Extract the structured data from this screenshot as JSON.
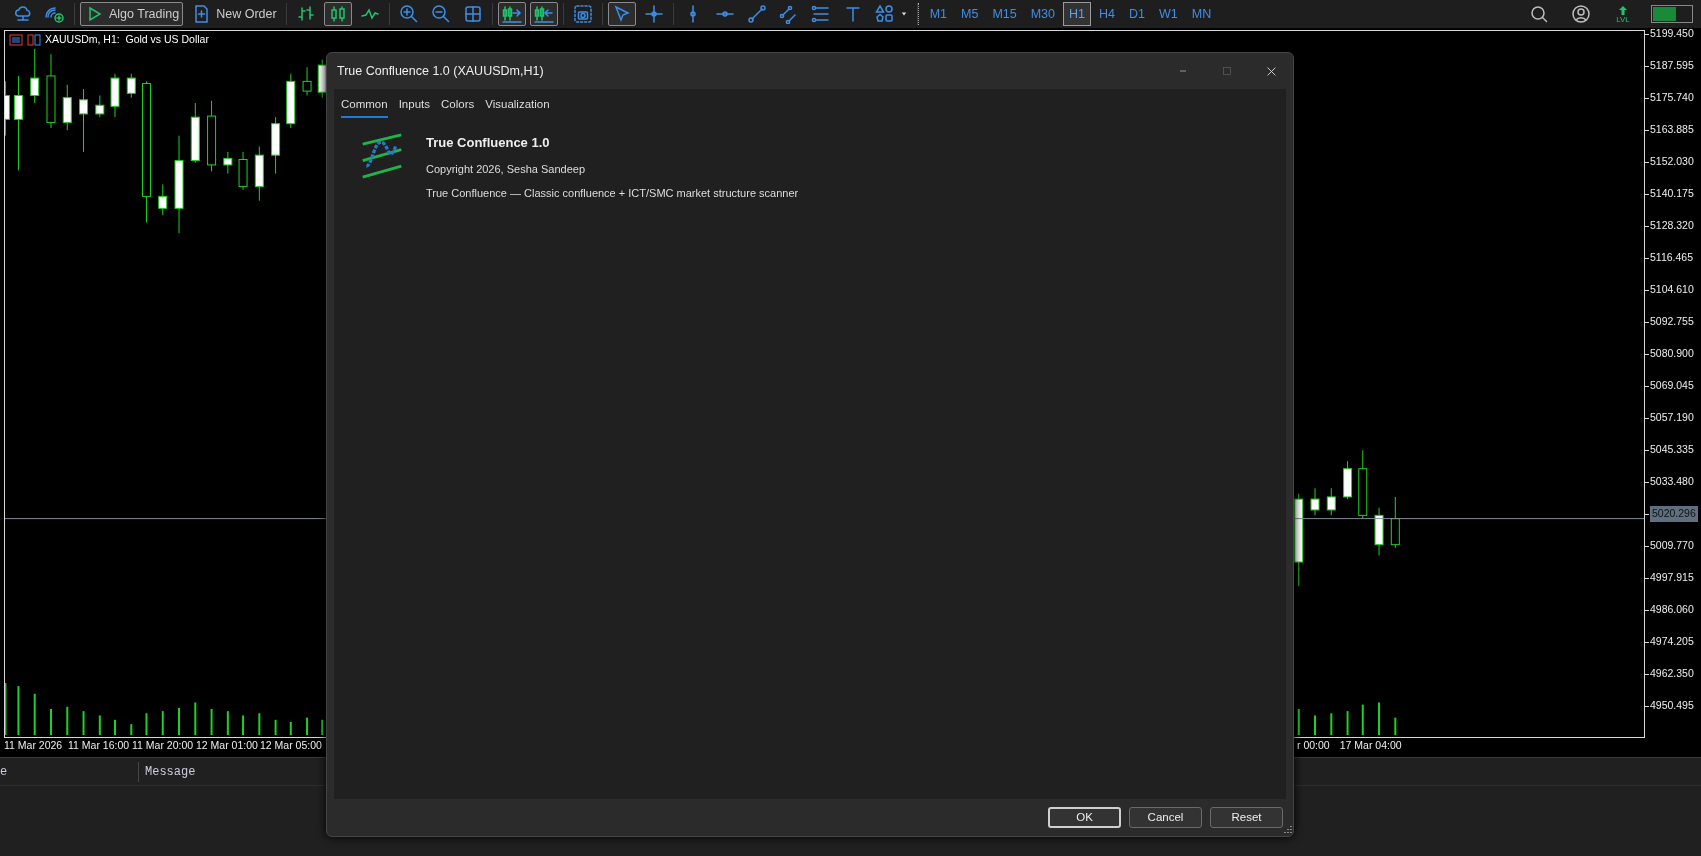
{
  "toolbar": {
    "groups": [
      [
        {
          "kind": "cloud",
          "pressed": false
        },
        {
          "kind": "signals",
          "pressed": false
        }
      ],
      [
        {
          "kind": "algo",
          "label": "Algo Trading",
          "pressed": true
        },
        {
          "kind": "new_order",
          "label": "New Order",
          "pressed": false
        }
      ],
      [
        {
          "kind": "bars",
          "pressed": false
        },
        {
          "kind": "candles",
          "pressed": true
        },
        {
          "kind": "line",
          "pressed": false
        }
      ],
      [
        {
          "kind": "zoom_in",
          "pressed": false
        },
        {
          "kind": "zoom_out",
          "pressed": false
        },
        {
          "kind": "grid",
          "pressed": false
        }
      ],
      [
        {
          "kind": "shift",
          "pressed": true
        },
        {
          "kind": "autoscroll",
          "pressed": true
        }
      ],
      [
        {
          "kind": "camera",
          "pressed": false
        }
      ],
      [
        {
          "kind": "cursor",
          "pressed": true
        },
        {
          "kind": "crosshair",
          "pressed": false
        }
      ],
      [
        {
          "kind": "vline",
          "pressed": false
        },
        {
          "kind": "hline",
          "pressed": false
        },
        {
          "kind": "trend",
          "pressed": false
        },
        {
          "kind": "channel",
          "pressed": false
        },
        {
          "kind": "fibo",
          "pressed": false
        },
        {
          "kind": "text",
          "pressed": false
        },
        {
          "kind": "shapes",
          "pressed": false
        }
      ]
    ],
    "timeframes": [
      {
        "label": "M1",
        "selected": false
      },
      {
        "label": "M5",
        "selected": false
      },
      {
        "label": "M15",
        "selected": false
      },
      {
        "label": "M30",
        "selected": false
      },
      {
        "label": "H1",
        "selected": true
      },
      {
        "label": "H4",
        "selected": false
      },
      {
        "label": "D1",
        "selected": false
      },
      {
        "label": "W1",
        "selected": false
      },
      {
        "label": "MN",
        "selected": false
      }
    ],
    "lvl": "LVL",
    "meter": {
      "level": 0.6
    }
  },
  "chart": {
    "title": "XAUUSDm, H1:  Gold vs US Dollar",
    "price_axis": [
      {
        "text": "5199.450",
        "kind": "tick"
      },
      {
        "text": "5187.595",
        "kind": "tick"
      },
      {
        "text": "5175.740",
        "kind": "tick"
      },
      {
        "text": "5163.885",
        "kind": "tick"
      },
      {
        "text": "5152.030",
        "kind": "tick"
      },
      {
        "text": "5140.175",
        "kind": "tick"
      },
      {
        "text": "5128.320",
        "kind": "tick"
      },
      {
        "text": "5116.465",
        "kind": "tick"
      },
      {
        "text": "5104.610",
        "kind": "tick"
      },
      {
        "text": "5092.755",
        "kind": "tick"
      },
      {
        "text": "5080.900",
        "kind": "tick"
      },
      {
        "text": "5069.045",
        "kind": "tick"
      },
      {
        "text": "5057.190",
        "kind": "tick"
      },
      {
        "text": "5045.335",
        "kind": "tick"
      },
      {
        "text": "5033.480",
        "kind": "tick"
      },
      {
        "text": "5020.296",
        "kind": "current"
      },
      {
        "text": "5009.770",
        "kind": "tick"
      },
      {
        "text": "4997.915",
        "kind": "tick"
      },
      {
        "text": "4986.060",
        "kind": "tick"
      },
      {
        "text": "4974.205",
        "kind": "tick"
      },
      {
        "text": "4962.350",
        "kind": "tick"
      },
      {
        "text": "4950.495",
        "kind": "tick"
      }
    ],
    "time_axis_left": [
      "11 Mar 2026",
      "11 Mar 16:00",
      "11 Mar 20:00",
      "12 Mar 01:00",
      "12 Mar 05:00"
    ],
    "time_axis_right": [
      "r 00:00",
      "17 Mar 04:00"
    ]
  },
  "log_panel": {
    "columns": [
      "e",
      "Message"
    ]
  },
  "dialog": {
    "title": "True Confluence 1.0 (XAUUSDm,H1)",
    "tabs": [
      {
        "label": "Common",
        "selected": true
      },
      {
        "label": "Inputs",
        "selected": false
      },
      {
        "label": "Colors",
        "selected": false
      },
      {
        "label": "Visualization",
        "selected": false
      }
    ],
    "name": "True Confluence 1.0",
    "copyright": "Copyright 2026, Sesha Sandeep",
    "description": "True Confluence — Classic confluence + ICT/SMC market structure scanner",
    "buttons": [
      {
        "label": "OK",
        "default": true
      },
      {
        "label": "Cancel",
        "default": false
      },
      {
        "label": "Reset",
        "default": false
      }
    ]
  }
}
